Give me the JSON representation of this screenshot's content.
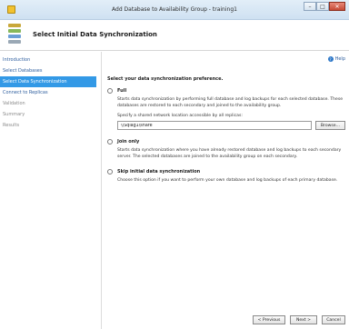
{
  "window": {
    "title": "Add Database to Availability Group - training1",
    "minimize_glyph": "–",
    "maximize_glyph": "□",
    "close_glyph": "✕"
  },
  "header": {
    "page_title": "Select Initial Data Synchronization"
  },
  "help": {
    "label": "Help",
    "icon_glyph": "?"
  },
  "sidebar": {
    "items": [
      {
        "label": "Introduction",
        "state": "link"
      },
      {
        "label": "Select Databases",
        "state": "link"
      },
      {
        "label": "Select Data Synchronization",
        "state": "active"
      },
      {
        "label": "Connect to Replicas",
        "state": "link"
      },
      {
        "label": "Validation",
        "state": "disabled"
      },
      {
        "label": "Summary",
        "state": "disabled"
      },
      {
        "label": "Results",
        "state": "disabled"
      }
    ]
  },
  "main": {
    "prompt": "Select your data synchronization preference.",
    "options": {
      "full": {
        "label": "Full",
        "description": "Starts data synchronization by performing full database and log backups for each selected database. These databases are restored to each secondary and joined to the availability group."
      },
      "join_only": {
        "label": "Join only",
        "description": "Starts data synchronization where you have already restored database and log backups to each secondary server. The selected databases are joined to the availability group on each secondary."
      },
      "skip": {
        "label": "Skip initial data synchronization",
        "description": "Choose this option if you want to perform your own database and log backups of each primary database."
      }
    },
    "share": {
      "label": "Specify a shared network location accessible by all replicas:",
      "value": "\\\\Sqlag1\\share",
      "browse_label": "Browse..."
    }
  },
  "footer": {
    "previous_label": "< Previous",
    "next_label": "Next >",
    "cancel_label": "Cancel"
  }
}
